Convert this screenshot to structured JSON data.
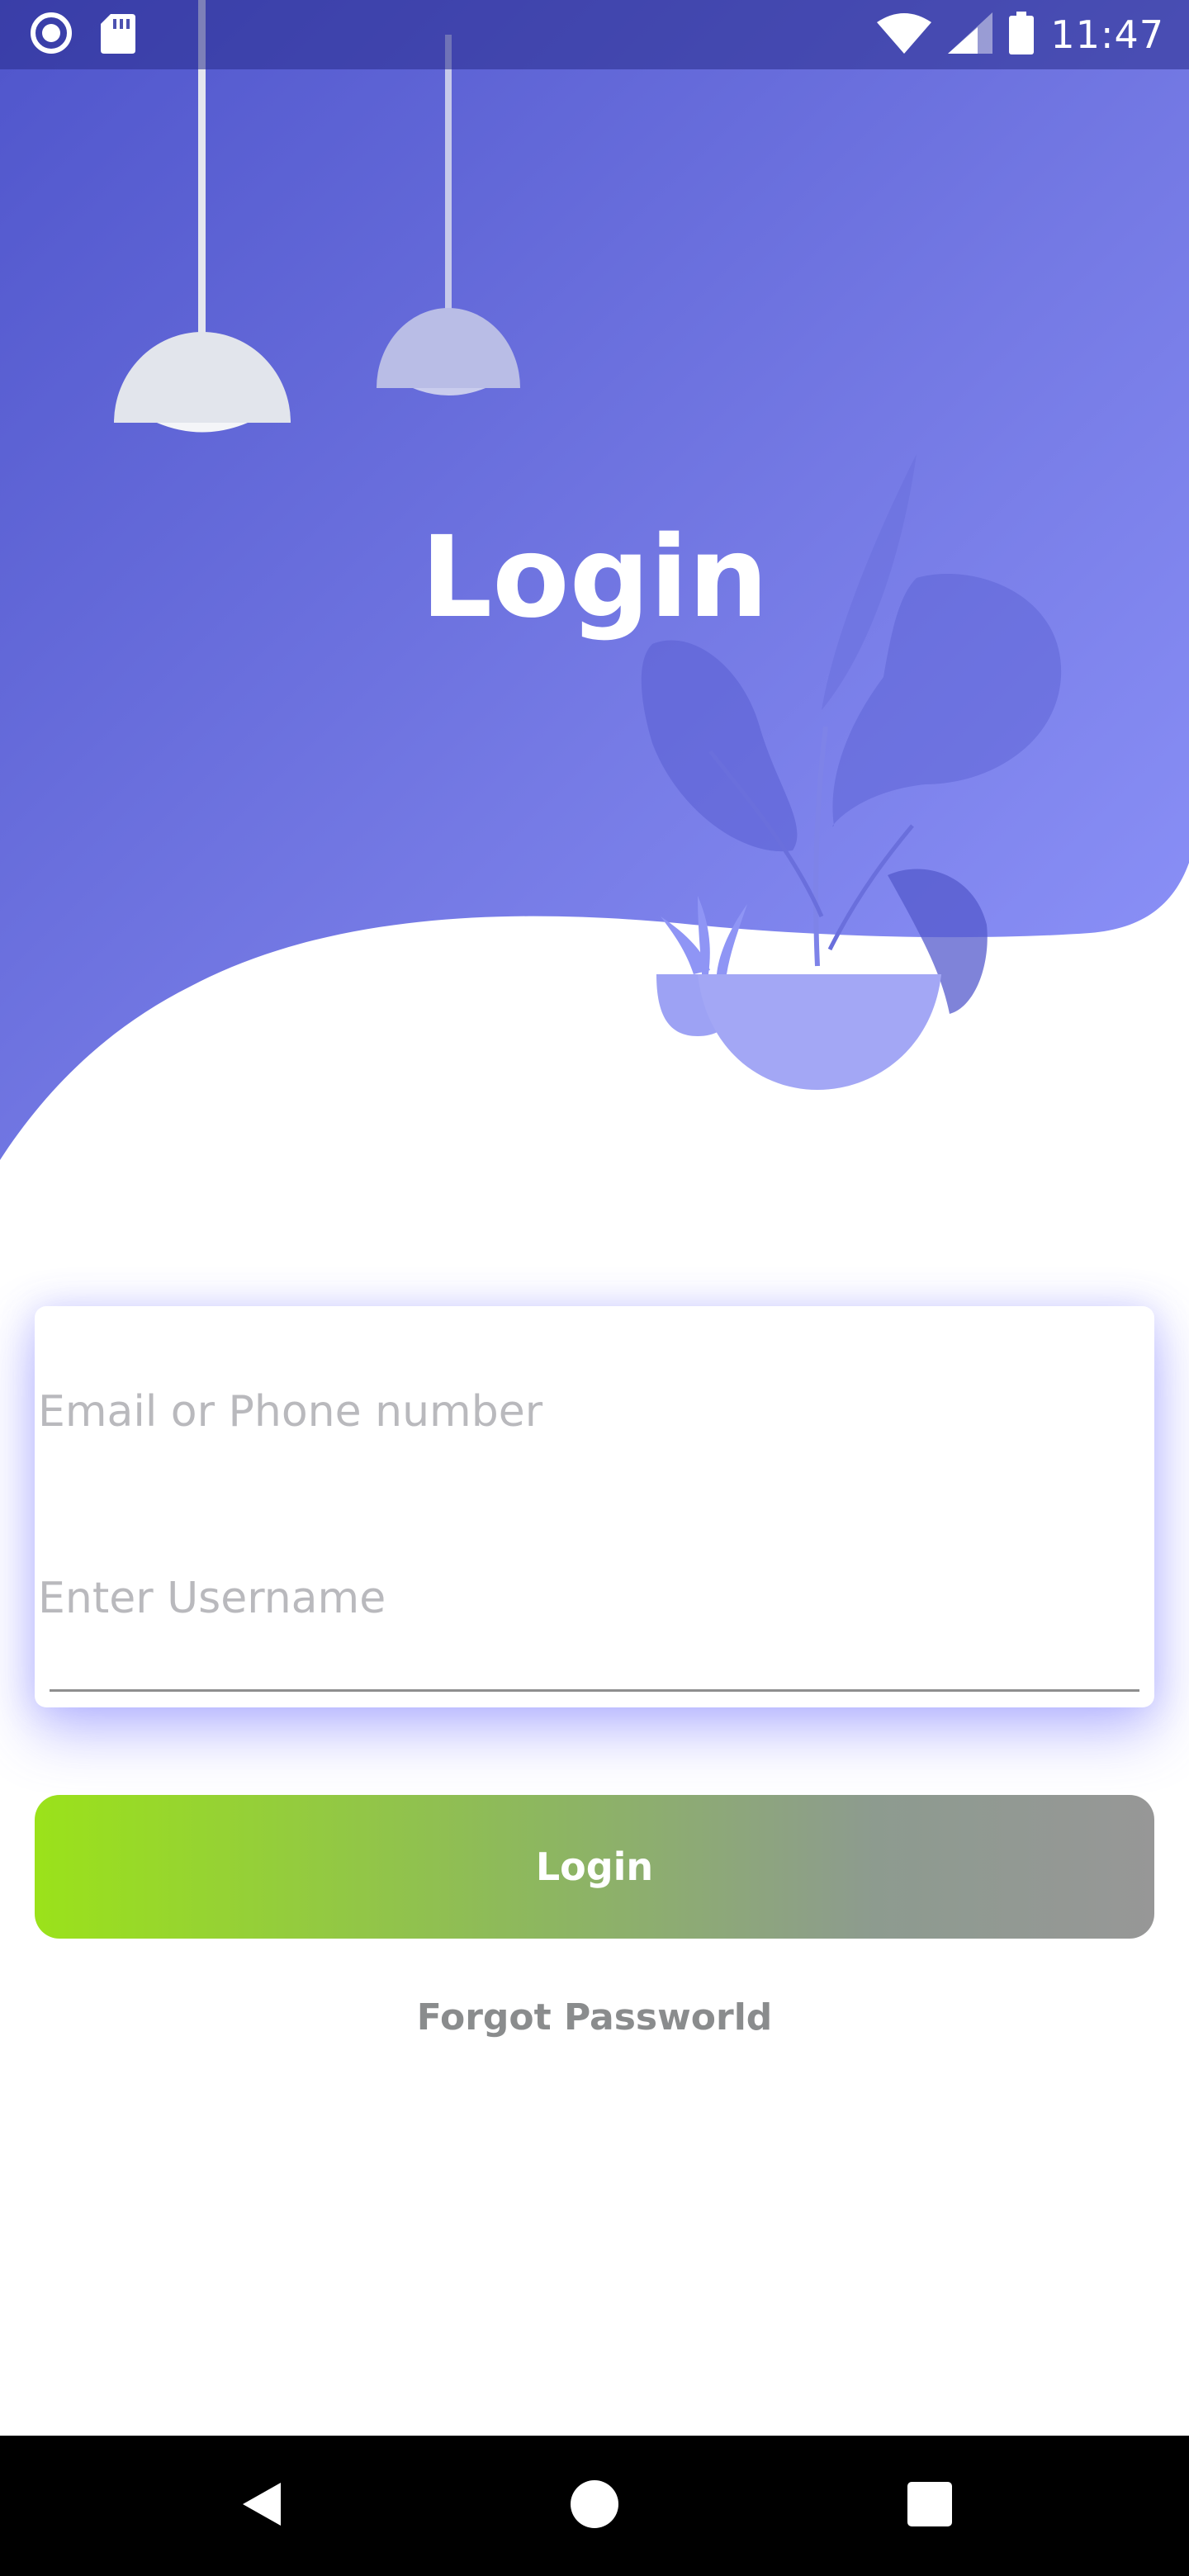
{
  "status_bar": {
    "time": "11:47",
    "icons_left": [
      "record-icon",
      "sd-card-icon"
    ],
    "icons_right": [
      "wifi-icon",
      "cellular-signal-icon",
      "battery-icon"
    ]
  },
  "hero": {
    "title": "Login",
    "gradient": {
      "from": "#5058cc",
      "to": "#8f95fb"
    },
    "illustration": [
      "pendant-lamp",
      "pendant-lamp",
      "potted-plant",
      "small-plant"
    ]
  },
  "form": {
    "email_placeholder": "Email or Phone number",
    "username_placeholder": "Enter Username",
    "login_label": "Login",
    "forgot_label": "Forgot Passworld"
  },
  "colors": {
    "button_start": "#9be21a",
    "button_end": "#979797",
    "accent": "#6b6fe6"
  },
  "nav_bar": {
    "buttons": [
      "back-icon",
      "home-icon",
      "recents-icon"
    ]
  }
}
